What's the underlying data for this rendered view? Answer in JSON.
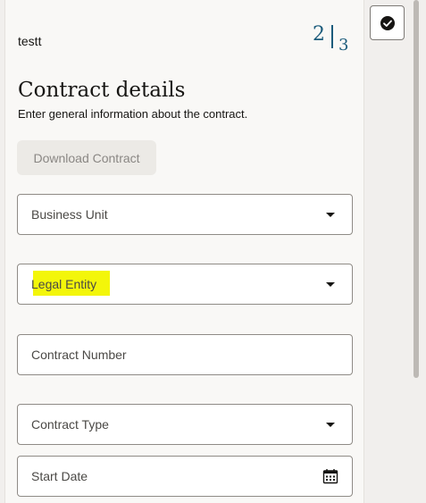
{
  "header": {
    "record_name": "testt",
    "step_current": "2",
    "step_total": "3"
  },
  "section": {
    "title": "Contract details",
    "subtitle": "Enter general information about the contract."
  },
  "actions": {
    "download_label": "Download Contract"
  },
  "form": {
    "fields": [
      {
        "label": "Business Unit",
        "type": "select"
      },
      {
        "label": "Legal Entity",
        "type": "select",
        "highlighted": true
      },
      {
        "label": "Contract Number",
        "type": "text"
      },
      {
        "label": "Contract Type",
        "type": "select"
      },
      {
        "label": "Start Date",
        "type": "date"
      }
    ]
  },
  "icons": {
    "rail": "check-circle-icon",
    "select": "chevron-down-icon",
    "date": "calendar-icon"
  },
  "colors": {
    "accent": "#1c5c7c",
    "highlight": "#f3f60a",
    "panel_bg": "#f9f8f6",
    "page_bg": "#f1efed"
  }
}
